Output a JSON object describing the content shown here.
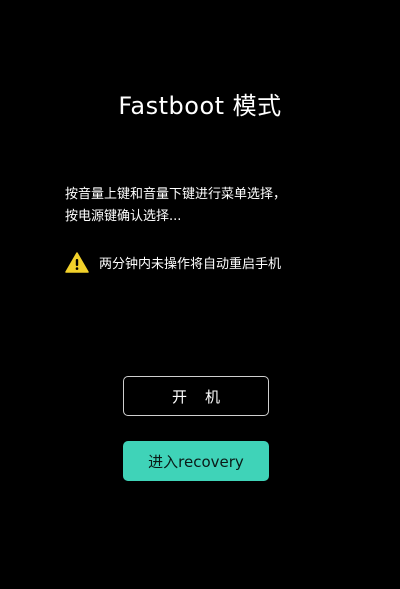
{
  "screen": {
    "title": "Fastboot 模式",
    "instructions": [
      "按音量上键和音量下键进行菜单选择，",
      "按电源键确认选择..."
    ],
    "warning": {
      "icon": "warning-triangle-icon",
      "text": "两分钟内未操作将自动重启手机"
    }
  },
  "buttons": {
    "power_on": "开机",
    "recovery": "进入recovery"
  },
  "colors": {
    "background": "#000000",
    "accent": "#3fd3b8",
    "warning": "#f2d12a"
  }
}
